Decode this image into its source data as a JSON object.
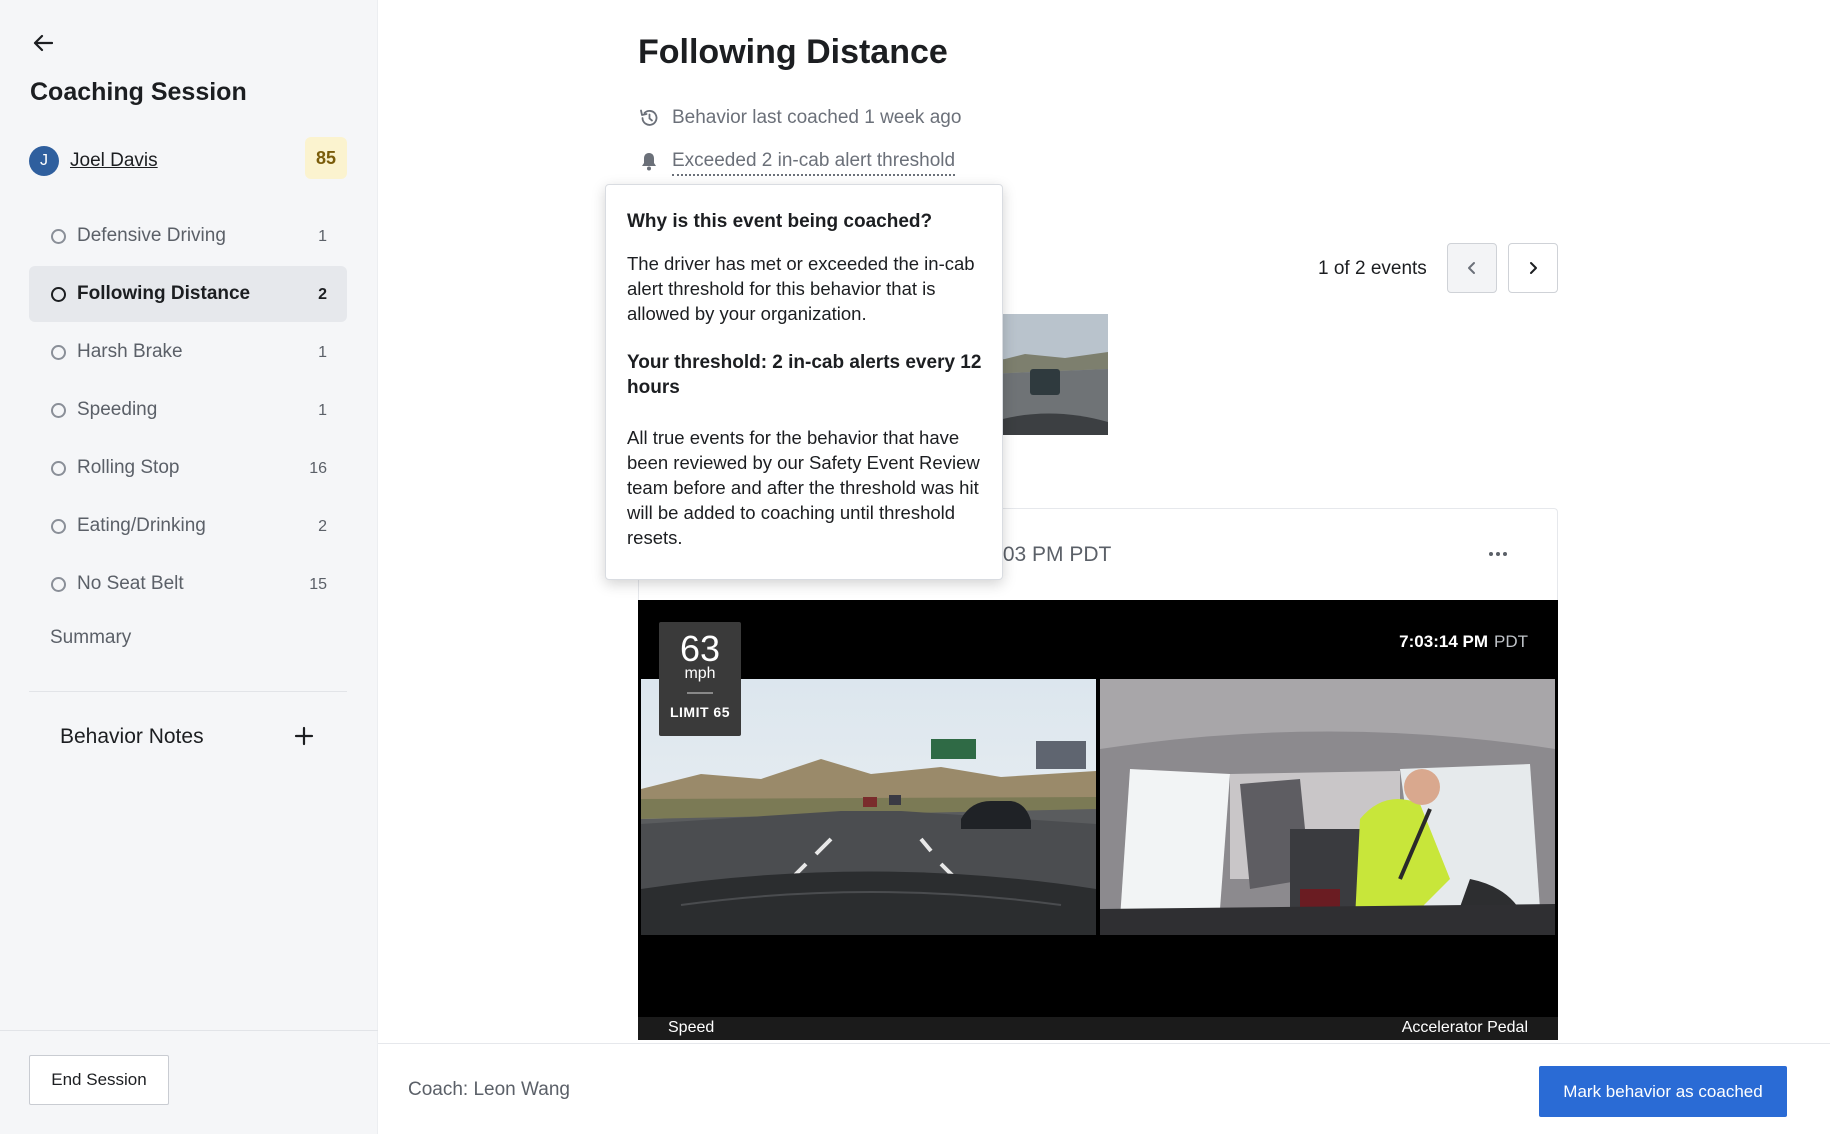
{
  "sidebar": {
    "title": "Coaching Session",
    "driver": {
      "initial": "J",
      "name": "Joel Davis",
      "score": "85"
    },
    "behaviors": [
      {
        "label": "Defensive Driving",
        "count": "1"
      },
      {
        "label": "Following Distance",
        "count": "2"
      },
      {
        "label": "Harsh Brake",
        "count": "1"
      },
      {
        "label": "Speeding",
        "count": "1"
      },
      {
        "label": "Rolling Stop",
        "count": "16"
      },
      {
        "label": "Eating/Drinking",
        "count": "2"
      },
      {
        "label": "No Seat Belt",
        "count": "15"
      }
    ],
    "active_behavior": "Following Distance",
    "summary_label": "Summary",
    "notes_label": "Behavior Notes",
    "end_session_label": "End Session"
  },
  "main": {
    "title": "Following Distance",
    "last_coached": "Behavior last coached 1 week ago",
    "threshold_text": "Exceeded 2 in-cab alert threshold",
    "events_counter": "1 of 2 events",
    "event_time_partial": ":03 PM PDT",
    "video": {
      "timestamp": "7:03:14 PM",
      "timezone": "PDT",
      "speed": "63",
      "speed_unit": "mph",
      "speed_limit": "LIMIT 65",
      "telemetry_left": "Speed",
      "telemetry_right": "Accelerator Pedal"
    }
  },
  "tooltip": {
    "heading": "Why is this event being coached?",
    "body": "The driver has met or exceeded the in-cab alert threshold for this behavior that is allowed by your organization.",
    "threshold": "Your threshold: 2 in-cab alerts every 12 hours",
    "details": "All true events for the behavior that have been reviewed by our Safety Event Review team before and after the threshold was hit will be added to coaching until threshold resets."
  },
  "footer": {
    "coach": "Coach: Leon Wang",
    "mark_label": "Mark behavior as coached"
  },
  "colors": {
    "accent": "#2a6bd5",
    "avatar": "#2f5f9e",
    "score_badge": "#fbf3cf",
    "sidebar_bg": "#f5f6f8"
  }
}
